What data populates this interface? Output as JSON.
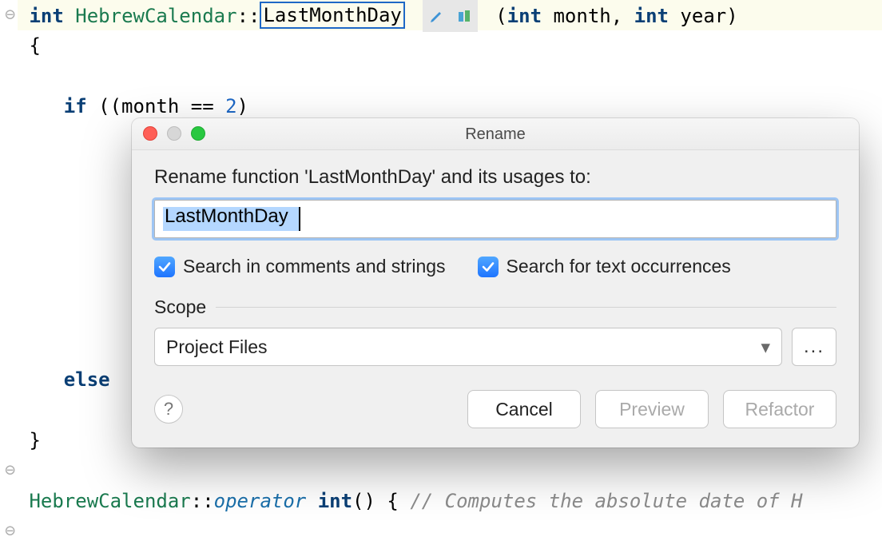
{
  "code": {
    "line1": {
      "kw_int": "int",
      "class": "HebrewCalendar",
      "sep": "::",
      "fn": "LastMonthDay",
      "params_open": "(",
      "p1_kw": "int",
      "p1_name": " month, ",
      "p2_kw": "int",
      "p2_name": " year",
      "params_close": ")"
    },
    "line2": "{",
    "line4_a": "    ",
    "line4_kw": "if",
    "line4_b": " ((month == ",
    "line4_num": "2",
    "line4_c": ")",
    "line13_a": "    ",
    "line13_kw": "else",
    "line15": "}",
    "line17_class": "HebrewCalendar",
    "line17_sep": "::",
    "line17_op": "operator",
    "line17_int": " int",
    "line17_paren": "()",
    "line17_brace": " { ",
    "line17_comment": "// Computes the absolute date of H"
  },
  "dialog": {
    "title": "Rename",
    "prompt": "Rename function 'LastMonthDay' and its usages to:",
    "input_value": "LastMonthDay",
    "chk_comments": "Search in comments and strings",
    "chk_text_occ": "Search for text occurrences",
    "scope_label": "Scope",
    "scope_value": "Project Files",
    "scope_more": "...",
    "help": "?",
    "cancel": "Cancel",
    "preview": "Preview",
    "refactor": "Refactor"
  }
}
